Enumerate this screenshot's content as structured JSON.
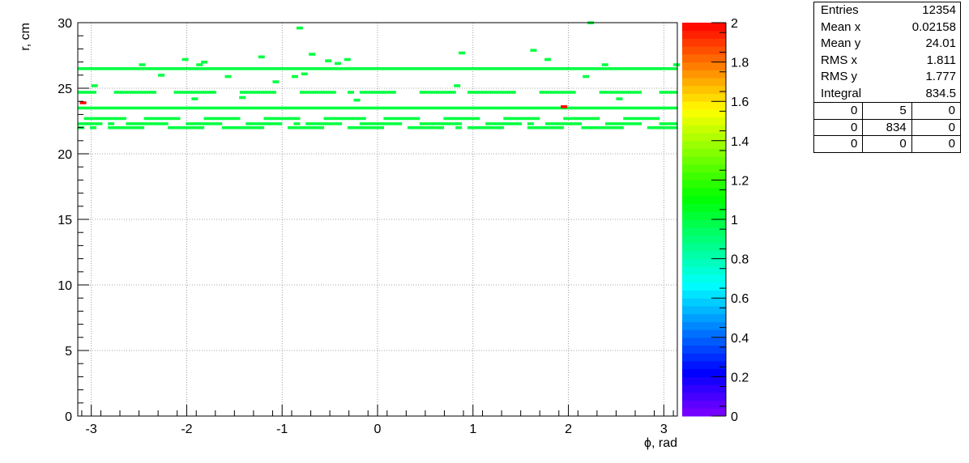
{
  "chart_data": {
    "type": "heatmap",
    "xlabel": "ϕ, rad",
    "ylabel": "r, cm",
    "xlim": [
      -3.1416,
      3.1416
    ],
    "ylim": [
      0,
      30
    ],
    "x_ticks": [
      -3,
      -2,
      -1,
      0,
      1,
      2,
      3
    ],
    "y_ticks": [
      0,
      5,
      10,
      15,
      20,
      25,
      30
    ],
    "grid": true,
    "color_scale": {
      "min": 0,
      "max": 2,
      "ticks": [
        "0",
        "0.2",
        "0.4",
        "0.6",
        "0.8",
        "1",
        "1.2",
        "1.4",
        "1.6",
        "1.8",
        "2"
      ]
    },
    "bin_size": {
      "x": 0.0628,
      "y": 0.2
    },
    "bands": [
      {
        "r": 26.4,
        "phi_from": -3.14,
        "phi_to": 3.14,
        "content": 1
      },
      {
        "r": 24.6,
        "phi_from": -3.14,
        "phi_to": 3.14,
        "content": 1,
        "sparse": true
      },
      {
        "r": 23.4,
        "phi_from": -3.14,
        "phi_to": 3.14,
        "content": 1
      },
      {
        "r": 22.6,
        "phi_from": -3.14,
        "phi_to": 3.14,
        "content": 1,
        "sparse": true
      },
      {
        "r": 22.2,
        "phi_from": -3.14,
        "phi_to": 3.14,
        "content": 1,
        "sparse": true
      },
      {
        "r": 21.9,
        "phi_from": -3.14,
        "phi_to": 3.14,
        "content": 1,
        "sparse": true
      }
    ],
    "cells": [
      [
        -3.12,
        23.8,
        2
      ],
      [
        1.92,
        23.5,
        2
      ],
      [
        -2.5,
        26.7,
        1
      ],
      [
        -1.25,
        27.3,
        1
      ],
      [
        -0.85,
        29.5,
        1
      ],
      [
        -0.55,
        27.0,
        1
      ],
      [
        -0.72,
        27.5,
        1
      ],
      [
        0.85,
        27.6,
        1
      ],
      [
        1.6,
        27.8,
        1
      ],
      [
        1.75,
        27.1,
        1
      ],
      [
        2.2,
        29.9,
        1
      ],
      [
        -2.05,
        27.1,
        1
      ],
      [
        -1.85,
        26.9,
        1
      ],
      [
        -0.45,
        26.8,
        1
      ],
      [
        -0.35,
        27.1,
        1
      ],
      [
        -1.6,
        25.8,
        1
      ],
      [
        -1.1,
        25.4,
        1
      ],
      [
        -0.8,
        26.0,
        1
      ],
      [
        0.8,
        25.1,
        1
      ],
      [
        2.15,
        25.8,
        1
      ],
      [
        -2.3,
        25.9,
        1
      ],
      [
        -0.9,
        25.8,
        1
      ],
      [
        -1.45,
        24.2,
        1
      ],
      [
        -0.25,
        24.0,
        1
      ],
      [
        -3.0,
        25.1,
        1
      ],
      [
        -1.95,
        24.1,
        1
      ],
      [
        2.5,
        24.1,
        1
      ],
      [
        -1.9,
        26.7,
        1
      ],
      [
        2.35,
        26.7,
        1
      ],
      [
        3.1,
        26.7,
        1
      ]
    ]
  },
  "stats_box": {
    "rows": [
      {
        "label": "Entries",
        "value": "12354"
      },
      {
        "label": "Mean x",
        "value": "0.02158"
      },
      {
        "label": "Mean y",
        "value": "24.01"
      },
      {
        "label": "RMS x",
        "value": "1.811"
      },
      {
        "label": "RMS y",
        "value": "1.777"
      },
      {
        "label": "Integral",
        "value": "834.5"
      }
    ],
    "grid": [
      [
        "0",
        "5",
        "0"
      ],
      [
        "0",
        "834",
        "0"
      ],
      [
        "0",
        "0",
        "0"
      ]
    ]
  }
}
